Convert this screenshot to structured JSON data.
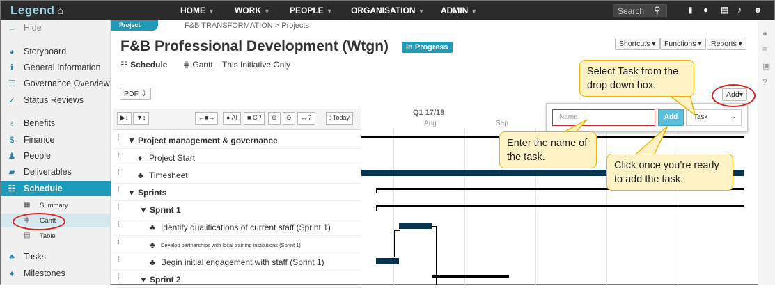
{
  "app": {
    "logo": "Legend",
    "home_icon": "home-icon"
  },
  "nav": [
    {
      "label": "HOME"
    },
    {
      "label": "WORK"
    },
    {
      "label": "PEOPLE"
    },
    {
      "label": "ORGANISATION"
    },
    {
      "label": "ADMIN"
    }
  ],
  "search": {
    "placeholder": "Search"
  },
  "sidebar": {
    "hide": "Hide",
    "items": [
      {
        "label": "Storyboard"
      },
      {
        "label": "General Information"
      },
      {
        "label": "Governance Overview"
      },
      {
        "label": "Status Reviews"
      },
      {
        "label": "Benefits"
      },
      {
        "label": "Finance"
      },
      {
        "label": "People"
      },
      {
        "label": "Deliverables"
      },
      {
        "label": "Schedule"
      }
    ],
    "sub": [
      {
        "label": "Summary"
      },
      {
        "label": "Gantt"
      },
      {
        "label": "Table"
      }
    ],
    "after": [
      {
        "label": "Tasks"
      },
      {
        "label": "Milestones"
      }
    ]
  },
  "page": {
    "tag": "Project",
    "breadcrumb": "F&B TRANSFORMATION > Projects",
    "title": "F&B Professional Development (Wtgn)",
    "status": "In Progress",
    "view": "Schedule",
    "subview": "Gantt",
    "scope": "This Initiative Only",
    "pdf": "PDF",
    "shortcuts": "Shortcuts",
    "functions": "Functions",
    "reports": "Reports",
    "add": "Add"
  },
  "toolbar": {
    "ai": "AI",
    "cp": "CP",
    "today": "Today"
  },
  "tasks": [
    {
      "label": "Project management & governance"
    },
    {
      "label": "Project Start"
    },
    {
      "label": "Timesheet"
    },
    {
      "label": "Sprints"
    },
    {
      "label": "Sprint 1"
    },
    {
      "label": "Identify qualifications of current staff (Sprint 1)"
    },
    {
      "label": "Develop partnerships with local training institutions (Sprint 1)"
    },
    {
      "label": "Begin initial engagement with staff (Sprint 1)"
    },
    {
      "label": "Sprint 2"
    }
  ],
  "chart": {
    "quarter": "Q1 17/18",
    "months": [
      "Aug",
      "Sep"
    ]
  },
  "popup": {
    "name_placeholder": "Name",
    "add_label": "Add",
    "type_value": "Task"
  },
  "callouts": {
    "select": "Select Task from the drop down box.",
    "name": "Enter the name of the task.",
    "click": "Click once you’re ready to add the task."
  }
}
